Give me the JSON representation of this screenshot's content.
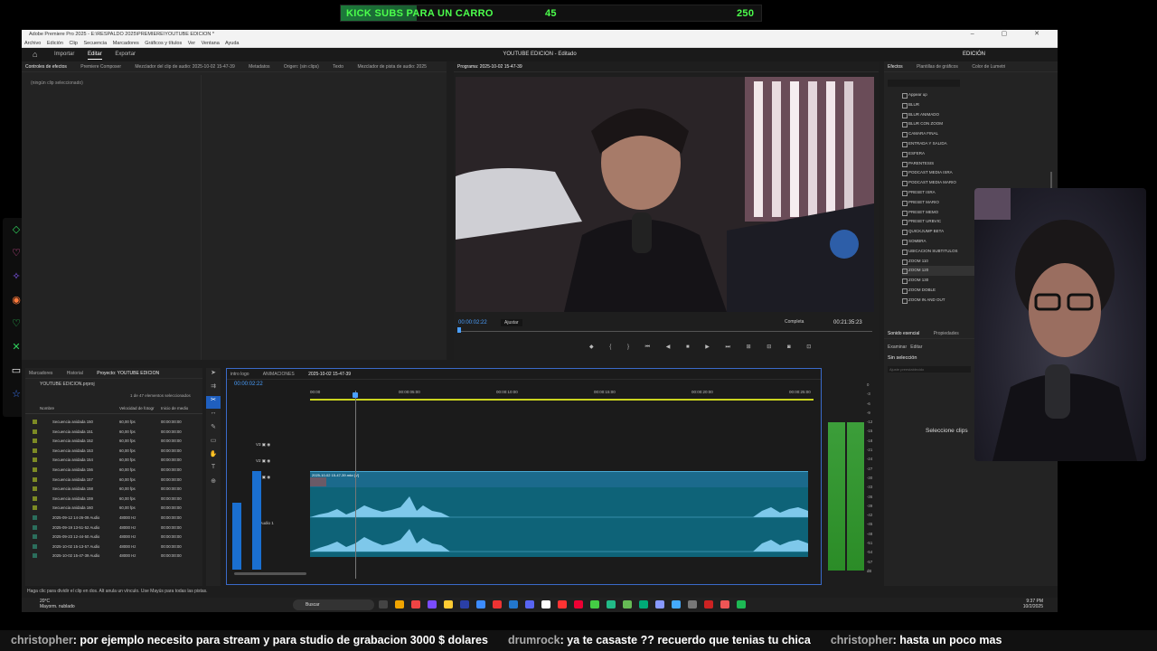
{
  "banner": {
    "text": "KICK SUBS PARA UN CARRO",
    "current": "45",
    "goal": "250",
    "progress": 0.18
  },
  "window": {
    "title": "Adobe Premiere Pro 2025 - E:\\RESPALDO 2025\\PREMIERE\\YOUTUBE EDICION *"
  },
  "menu": [
    "Archivo",
    "Edición",
    "Clip",
    "Secuencia",
    "Marcadores",
    "Gráficos y títulos",
    "Ver",
    "Ventana",
    "Ayuda"
  ],
  "workspace": {
    "tabs": [
      "Importar",
      "Editar",
      "Exportar"
    ],
    "active": "Editar",
    "project_title": "YOUTUBE EDICION - Editado",
    "workspace_label": "EDICIÓN"
  },
  "source_panel": {
    "tabs": [
      "Controles de efectos",
      "Premiere Composer",
      "Mezclador del clip de audio: 2025-10-02 15-47-39",
      "Metadatos",
      "Origen: (sin clips)",
      "Texto",
      "Mezclador de pista de audio: 2025"
    ],
    "empty_note": "(ningún clip seleccionado)"
  },
  "program": {
    "tab": "Programa: 2025-10-02 15-47-39",
    "timecode": "00:00:02:22",
    "fit": "Ajustar",
    "quality": "Completa",
    "duration": "00:21:35:23"
  },
  "effects_panel": {
    "tabs": [
      "Efectos",
      "Plantillas de gráficos",
      "Color de Lumetri"
    ],
    "items": [
      "Appear up",
      "BLUR",
      "BLUR ANIMADO",
      "BLUR CON ZOOM",
      "CAMARA FINAL",
      "ENTRADA Y SALIDA",
      "ESFERA",
      "PARENTESIS",
      "PODCAST MEDIA ISRA",
      "PODCAST MEDIA MARIO",
      "PRESET ISRA",
      "PRESET MARIO",
      "PRESET MEMO",
      "PRESET URBVIC",
      "QUICKJUMP BETA",
      "SOMBRA",
      "UBICACION SUBTITULOS",
      "ZOOM 110",
      "ZOOM 120",
      "ZOOM 130",
      "ZOOM DOBLE",
      "ZOOM IN AND OUT"
    ],
    "selected": "ZOOM 120"
  },
  "essential_sound": {
    "tabs": [
      "Sonido esencial",
      "Propiedades"
    ],
    "subtabs": [
      "Examinar",
      "Editar"
    ],
    "no_selection": "Sin selección",
    "preset_placeholder": "Ajuste preestablecido",
    "hint": "Seleccione clips"
  },
  "project": {
    "tabs": [
      "Marcadores",
      "Historial",
      "Proyecto: YOUTUBE EDICION"
    ],
    "path": "YOUTUBE EDICION.prproj",
    "count": "1 de 47 elementos seleccionados",
    "columns": [
      "Nombre",
      "Velocidad de fotogr",
      "Inicio de medio"
    ],
    "rows": [
      {
        "name": "Secuencia anidada 150",
        "fps": "60,00 fps",
        "start": "00:00:00:00",
        "kind": "seq"
      },
      {
        "name": "Secuencia anidada 151",
        "fps": "60,00 fps",
        "start": "00:00:00:00",
        "kind": "seq"
      },
      {
        "name": "Secuencia anidada 152",
        "fps": "60,00 fps",
        "start": "00:00:00:00",
        "kind": "seq"
      },
      {
        "name": "Secuencia anidada 153",
        "fps": "60,00 fps",
        "start": "00:00:00:00",
        "kind": "seq"
      },
      {
        "name": "Secuencia anidada 154",
        "fps": "60,00 fps",
        "start": "00:00:00:00",
        "kind": "seq"
      },
      {
        "name": "Secuencia anidada 156",
        "fps": "60,00 fps",
        "start": "00:00:00:00",
        "kind": "seq"
      },
      {
        "name": "Secuencia anidada 157",
        "fps": "60,00 fps",
        "start": "00:00:00:00",
        "kind": "seq"
      },
      {
        "name": "Secuencia anidada 158",
        "fps": "60,00 fps",
        "start": "00:00:00:00",
        "kind": "seq"
      },
      {
        "name": "Secuencia anidada 159",
        "fps": "60,00 fps",
        "start": "00:00:00:00",
        "kind": "seq"
      },
      {
        "name": "Secuencia anidada 160",
        "fps": "60,00 fps",
        "start": "00:00:00:00",
        "kind": "seq"
      },
      {
        "name": "2025-09-12 14-26-09 Audio",
        "fps": "48000 Hz",
        "start": "00:00:00:00",
        "kind": "aud"
      },
      {
        "name": "2025-09-19 13-51-52 Audio",
        "fps": "48000 Hz",
        "start": "00:00:00:00",
        "kind": "aud"
      },
      {
        "name": "2025-09-23 12-44-50 Audio",
        "fps": "48000 Hz",
        "start": "00:00:00:00",
        "kind": "aud"
      },
      {
        "name": "2025-10-02 15-13-57 Audio",
        "fps": "48000 Hz",
        "start": "00:00:00:00",
        "kind": "aud"
      },
      {
        "name": "2025-10-02 15-47-39 Audio",
        "fps": "48000 Hz",
        "start": "00:00:00:00",
        "kind": "aud"
      }
    ]
  },
  "timeline": {
    "tabs": [
      "intro logo",
      "ANIMACIONES",
      "2025-10-02 15-47-39"
    ],
    "timecode": "00:00:02:22",
    "ruler": [
      "00:00",
      "00:00:05:00",
      "00:00:10:00",
      "00:00:15:00",
      "00:00:20:00",
      "00:00:25:00"
    ],
    "tracks": [
      "V3",
      "V2",
      "V1",
      "A1"
    ],
    "audio_track_label": "Audio 1",
    "clip_label": "2025-10-02 15-47-39.mkv [V]"
  },
  "meter_scale": [
    "0",
    "-3",
    "-6",
    "-9",
    "-12",
    "-15",
    "-18",
    "-21",
    "-24",
    "-27",
    "-30",
    "-33",
    "-36",
    "-39",
    "-42",
    "-45",
    "-48",
    "-51",
    "-54",
    "-57",
    "dB"
  ],
  "status": "Haga clic para dividir el clip en dos. Alt anula un vínculo. Use Mayús para todas las pistas.",
  "taskbar": {
    "temp": "20°C",
    "weather": "Mayorm. nublado",
    "search": "Buscar",
    "time": "9:37 PM",
    "date": "10/2/2025",
    "app_colors": [
      "#444",
      "#f0a400",
      "#e44",
      "#7a4cff",
      "#ffcc33",
      "#2a3fa6",
      "#3c8cff",
      "#e33",
      "#27c",
      "#5865f2",
      "#fff",
      "#f33",
      "#e03",
      "#4c4",
      "#2b8",
      "#6b5",
      "#0a7",
      "#89f",
      "#4af",
      "#777",
      "#c22",
      "#e55",
      "#1db954"
    ]
  },
  "ticker": [
    {
      "user": "christopher",
      "msg": ": por ejemplo necesito para stream y para studio de grabacion 3000 $ dolares"
    },
    {
      "user": "drumrock",
      "msg": ": ya te casaste ?? recuerdo que tenias tu chica"
    },
    {
      "user": "christopher",
      "msg": ": hasta un poco mas"
    }
  ]
}
